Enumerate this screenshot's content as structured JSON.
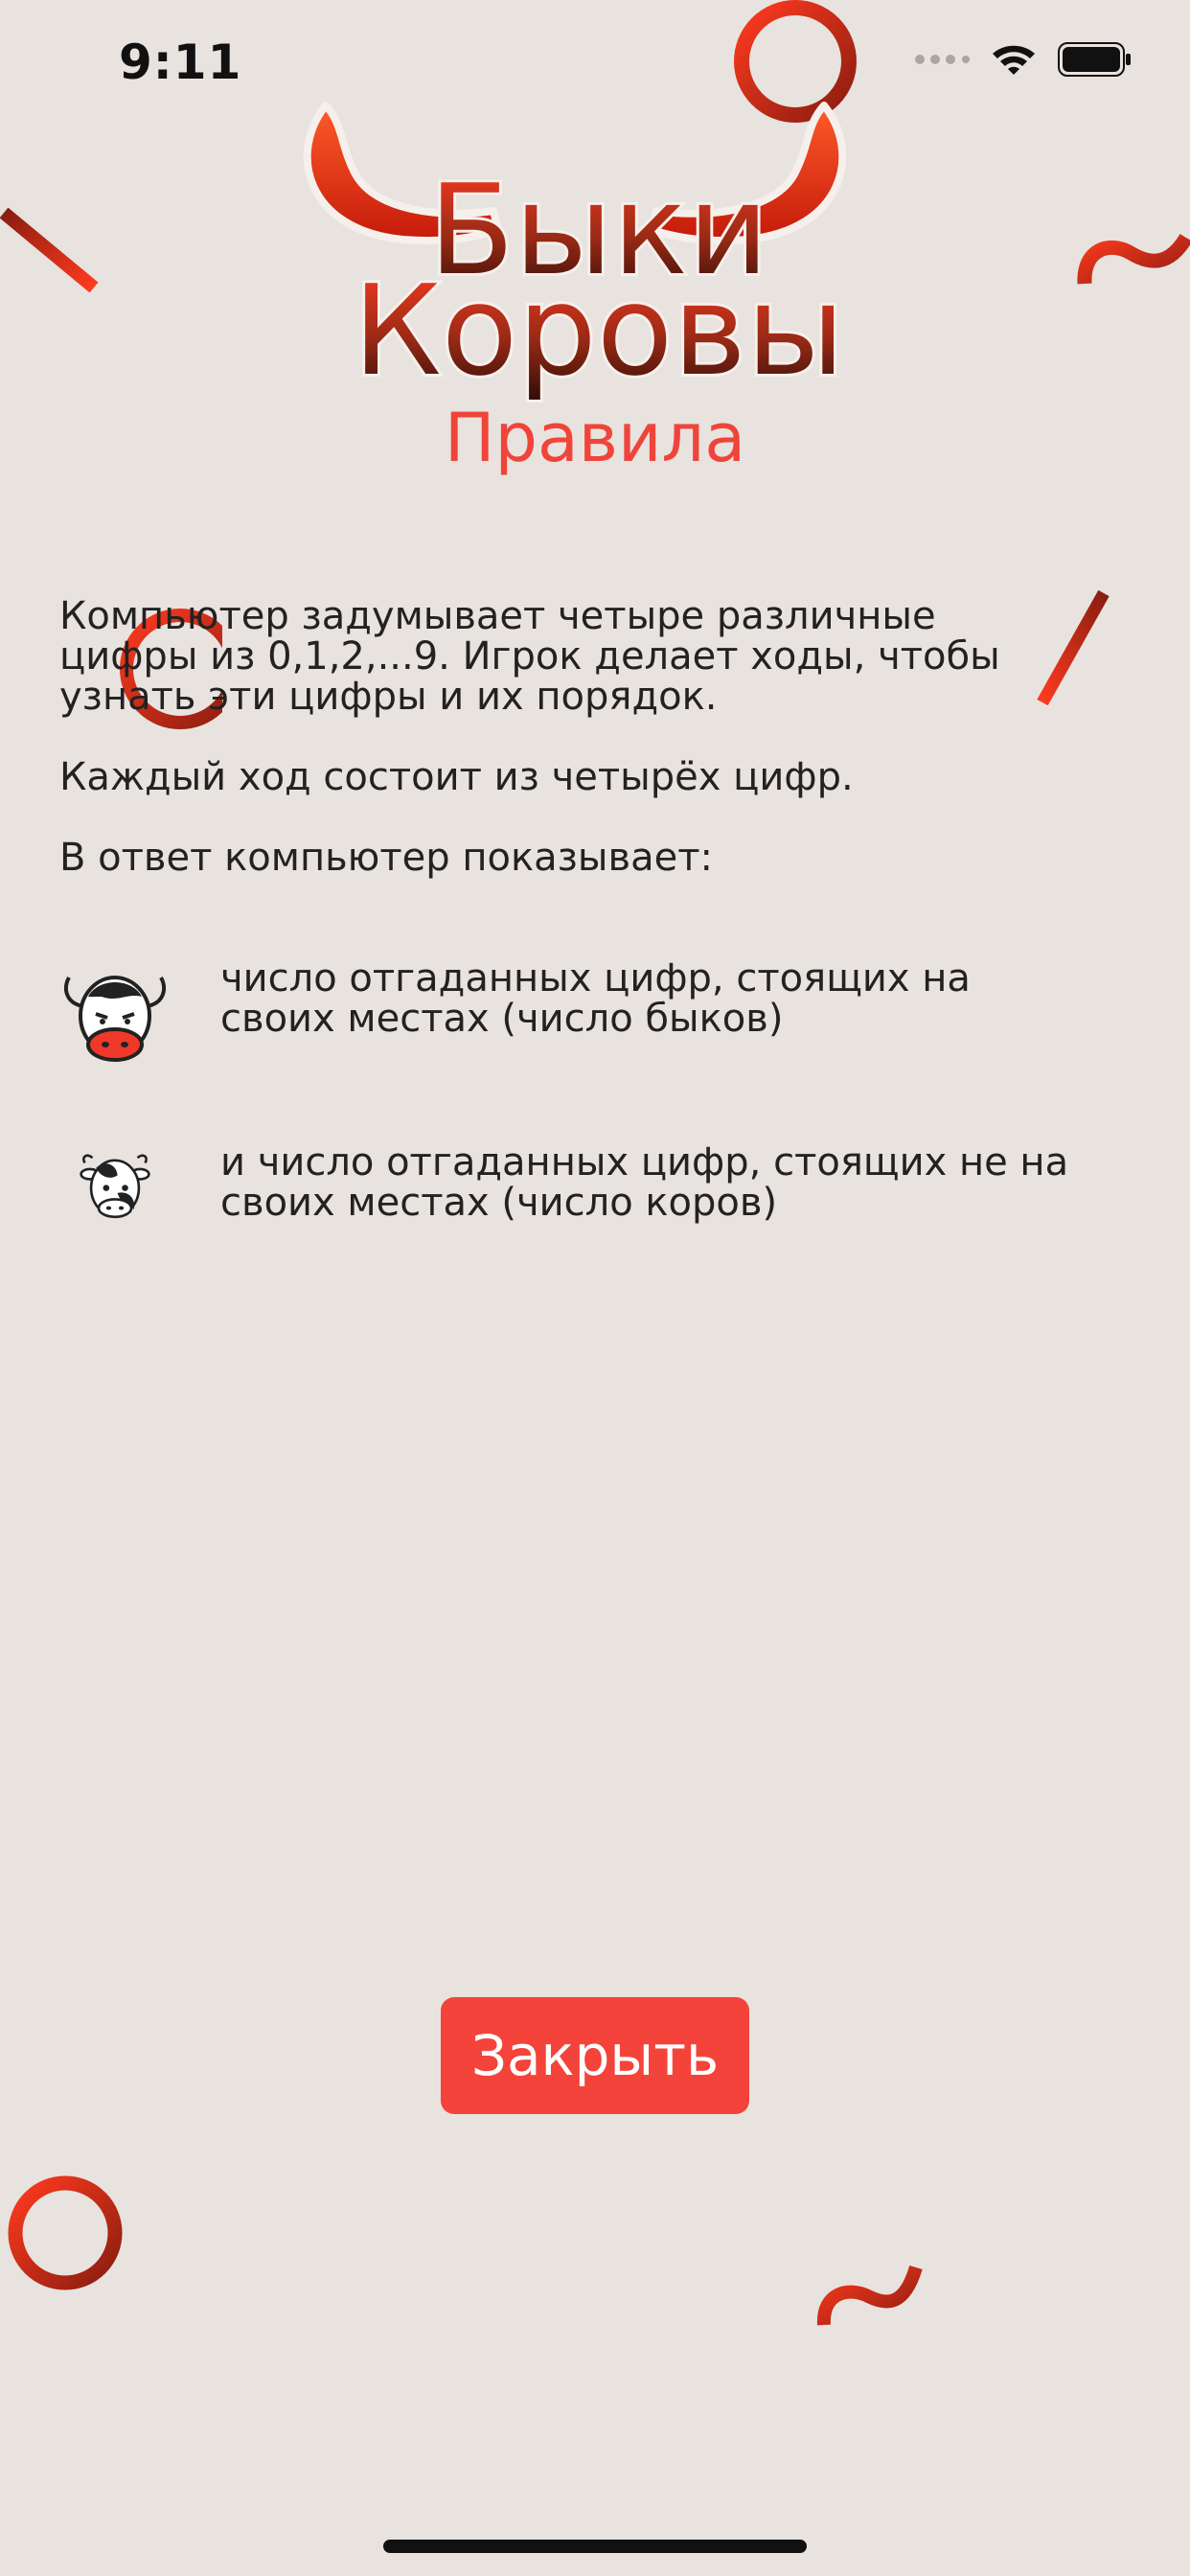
{
  "status_bar": {
    "time": "9:11"
  },
  "logo": {
    "line1": "Быки",
    "line2": "Коровы"
  },
  "page": {
    "title": "Правила"
  },
  "rules": {
    "paragraph1_line1": "Компьютер задумывает четыре различные",
    "paragraph1_line2": "цифры из 0,1,2,...9. Игрок делает ходы, чтобы",
    "paragraph1_line3": "узнать эти цифры и их порядок.",
    "paragraph2": "Каждый ход состоит из четырёх цифр.",
    "paragraph3": "В ответ компьютер показывает:",
    "bulls_line1": "число отгаданных цифр, стоящих на",
    "bulls_line2": "своих местах (число быков)",
    "cows_line1": "и число отгаданных цифр, стоящих не на",
    "cows_line2": "своих местах (число коров)"
  },
  "actions": {
    "close_label": "Закрыть"
  },
  "icons": {
    "bull": "bull-icon",
    "cow": "cow-icon",
    "wifi": "wifi-icon",
    "battery": "battery-icon",
    "signal": "signal-icon"
  },
  "colors": {
    "background": "#e8e3df",
    "accent": "#f4433a",
    "logo_dark": "#5a1a10",
    "text": "#222222"
  }
}
